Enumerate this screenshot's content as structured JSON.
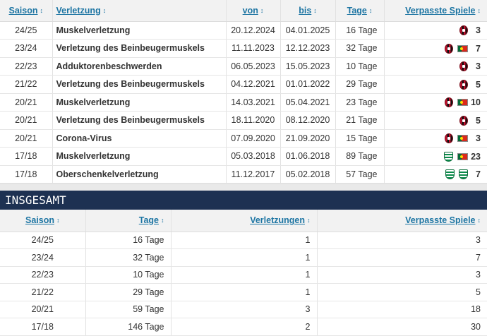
{
  "injuries": {
    "headers": {
      "season": "Saison",
      "injury": "Verletzung",
      "from": "von",
      "until": "bis",
      "days": "Tage",
      "missed": "Verpasste Spiele"
    },
    "sort_icon": "↕",
    "rows": [
      {
        "season": "24/25",
        "injury": "Muskelverletzung",
        "from": "20.12.2024",
        "until": "04.01.2025",
        "days": "16 Tage",
        "missed": "3",
        "badges": [
          "ac-milan-crest-icon"
        ]
      },
      {
        "season": "23/24",
        "injury": "Verletzung des Beinbeugermuskels",
        "from": "11.11.2023",
        "until": "12.12.2023",
        "days": "32 Tage",
        "missed": "7",
        "badges": [
          "ac-milan-crest-icon",
          "portugal-flag-icon"
        ]
      },
      {
        "season": "22/23",
        "injury": "Adduktorenbeschwerden",
        "from": "06.05.2023",
        "until": "15.05.2023",
        "days": "10 Tage",
        "missed": "3",
        "badges": [
          "ac-milan-crest-icon"
        ]
      },
      {
        "season": "21/22",
        "injury": "Verletzung des Beinbeugermuskels",
        "from": "04.12.2021",
        "until": "01.01.2022",
        "days": "29 Tage",
        "missed": "5",
        "badges": [
          "ac-milan-crest-icon"
        ]
      },
      {
        "season": "20/21",
        "injury": "Muskelverletzung",
        "from": "14.03.2021",
        "until": "05.04.2021",
        "days": "23 Tage",
        "missed": "10",
        "badges": [
          "ac-milan-crest-icon",
          "portugal-flag-icon"
        ]
      },
      {
        "season": "20/21",
        "injury": "Verletzung des Beinbeugermuskels",
        "from": "18.11.2020",
        "until": "08.12.2020",
        "days": "21 Tage",
        "missed": "5",
        "badges": [
          "ac-milan-crest-icon"
        ]
      },
      {
        "season": "20/21",
        "injury": "Corona-Virus",
        "from": "07.09.2020",
        "until": "21.09.2020",
        "days": "15 Tage",
        "missed": "3",
        "badges": [
          "ac-milan-crest-icon",
          "portugal-flag-icon"
        ]
      },
      {
        "season": "17/18",
        "injury": "Muskelverletzung",
        "from": "05.03.2018",
        "until": "01.06.2018",
        "days": "89 Tage",
        "missed": "23",
        "badges": [
          "sporting-crest-icon",
          "portugal-flag-icon"
        ]
      },
      {
        "season": "17/18",
        "injury": "Oberschenkelverletzung",
        "from": "11.12.2017",
        "until": "05.02.2018",
        "days": "57 Tage",
        "missed": "7",
        "badges": [
          "sporting-crest-icon",
          "sporting-crest-icon"
        ]
      }
    ]
  },
  "totals": {
    "title": "INSGESAMT",
    "headers": {
      "season": "Saison",
      "days": "Tage",
      "injuries": "Verletzungen",
      "missed": "Verpasste Spiele"
    },
    "rows": [
      {
        "season": "24/25",
        "days": "16 Tage",
        "injuries": "1",
        "missed": "3"
      },
      {
        "season": "23/24",
        "days": "32 Tage",
        "injuries": "1",
        "missed": "7"
      },
      {
        "season": "22/23",
        "days": "10 Tage",
        "injuries": "1",
        "missed": "3"
      },
      {
        "season": "21/22",
        "days": "29 Tage",
        "injuries": "1",
        "missed": "5"
      },
      {
        "season": "20/21",
        "days": "59 Tage",
        "injuries": "3",
        "missed": "18"
      },
      {
        "season": "17/18",
        "days": "146 Tage",
        "injuries": "2",
        "missed": "30"
      }
    ]
  },
  "colors": {
    "link": "#1d75a3",
    "section_header_bg": "#1d3152",
    "header_bg": "#f2f2f2"
  }
}
